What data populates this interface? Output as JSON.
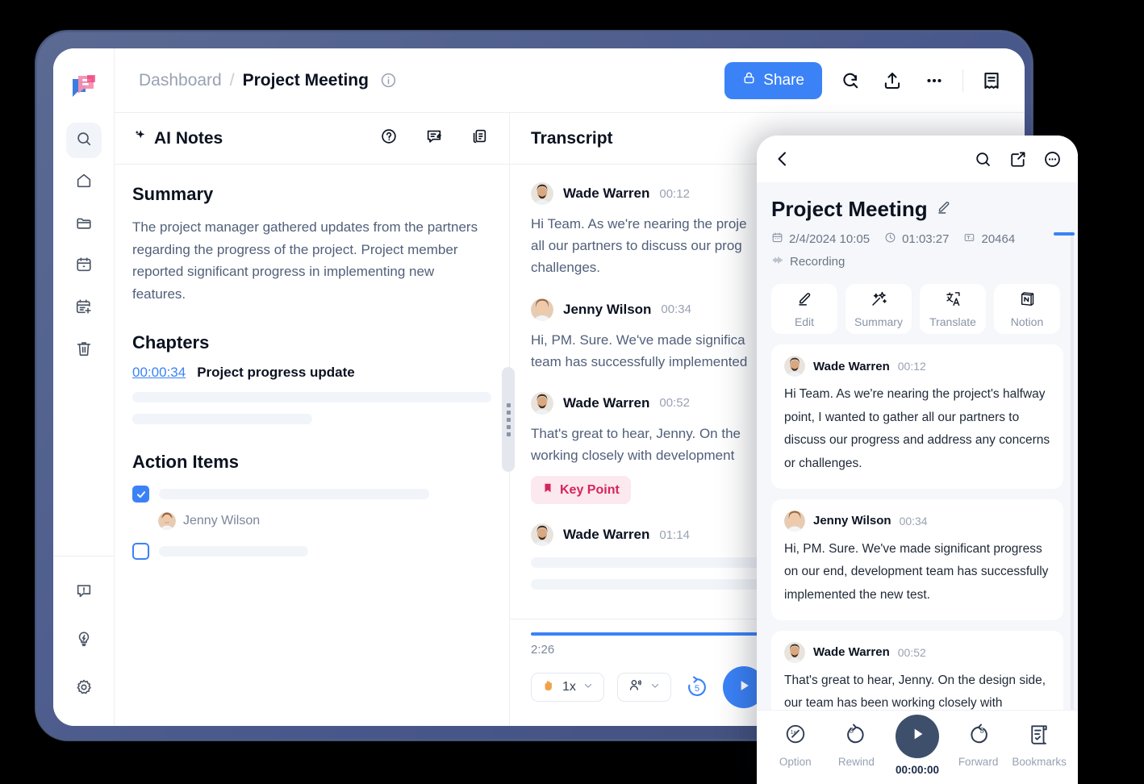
{
  "app": {
    "logo_icon": "app-logo-icon"
  },
  "sidebar": {
    "items": [
      {
        "name": "search",
        "icon": "search-icon",
        "active": true
      },
      {
        "name": "home",
        "icon": "home-icon",
        "active": false
      },
      {
        "name": "folder",
        "icon": "folder-icon",
        "active": false
      },
      {
        "name": "calendar",
        "icon": "calendar-icon",
        "active": false
      },
      {
        "name": "calendar-add",
        "icon": "calendar-plus-icon",
        "active": false
      },
      {
        "name": "trash",
        "icon": "trash-icon",
        "active": false
      }
    ],
    "bottom_items": [
      {
        "name": "feedback",
        "icon": "message-alert-icon"
      },
      {
        "name": "tips",
        "icon": "lightbulb-icon"
      },
      {
        "name": "settings",
        "icon": "gear-icon"
      }
    ]
  },
  "topbar": {
    "breadcrumb_root": "Dashboard",
    "breadcrumb_sep": "/",
    "breadcrumb_current": "Project Meeting",
    "info_icon": "info-circle-icon",
    "share_label": "Share",
    "share_icon": "lock-icon",
    "share_color": "#3b82f6",
    "actions": [
      {
        "name": "search-in-page",
        "icon": "search-refresh-icon"
      },
      {
        "name": "export",
        "icon": "upload-icon"
      },
      {
        "name": "more",
        "icon": "ellipsis-icon"
      },
      {
        "name": "notes-toggle",
        "icon": "receipt-icon"
      }
    ]
  },
  "notes_panel": {
    "title": "AI Notes",
    "title_icon": "sparkle-icon",
    "header_icons": [
      {
        "name": "help",
        "icon": "question-circle-icon"
      },
      {
        "name": "comment",
        "icon": "message-edit-icon"
      },
      {
        "name": "copy",
        "icon": "copy-icon"
      }
    ],
    "summary_heading": "Summary",
    "summary_text": "The project manager gathered updates from the partners regarding the progress of the project. Project member reported significant progress in implementing new features.",
    "chapters_heading": "Chapters",
    "chapter": {
      "time": "00:00:34",
      "title": "Project progress update"
    },
    "chapter_skeletons": [
      {
        "width": "100%"
      },
      {
        "width": "50%"
      }
    ],
    "action_items_heading": "Action Items",
    "action_items": [
      {
        "checked": true,
        "skeleton_width": "97%",
        "assignee": "Jenny Wilson"
      },
      {
        "checked": false,
        "skeleton_width": "54%",
        "assignee": null
      }
    ]
  },
  "transcript_panel": {
    "title": "Transcript",
    "entries": [
      {
        "speaker": "Wade Warren",
        "time": "00:12",
        "text": "Hi Team. As we're nearing the proje\nall our partners to discuss our prog\nchallenges.",
        "badge": null
      },
      {
        "speaker": "Jenny Wilson",
        "time": "00:34",
        "text": "Hi, PM. Sure. We've made significa\nteam has successfully implemented",
        "badge": null
      },
      {
        "speaker": "Wade Warren",
        "time": "00:52",
        "text": "That's great to hear, Jenny. On the\nworking closely with development",
        "badge": "Key Point"
      },
      {
        "speaker": "Wade Warren",
        "time": "01:14",
        "text": "",
        "badge": null
      }
    ],
    "key_point_label": "Key Point",
    "key_point_icon": "bookmark-icon",
    "key_point_color": "#d4265c"
  },
  "player": {
    "progress_percent": 82,
    "elapsed": "2:26",
    "speed_label": "1x",
    "speed_icon": "hand-icon",
    "speaker_icon": "speakers-icon",
    "rewind_label": "5",
    "rewind_icon": "rewind-5-icon",
    "play_icon": "play-icon"
  },
  "phone": {
    "topbar": {
      "back_icon": "chevron-left-icon",
      "actions": [
        {
          "name": "search",
          "icon": "search-icon"
        },
        {
          "name": "compose",
          "icon": "edit-square-icon"
        },
        {
          "name": "more",
          "icon": "ellipsis-circle-icon"
        }
      ]
    },
    "title": "Project Meeting",
    "title_edit_icon": "pencil-icon",
    "meta": {
      "date": "2/4/2024 10:05",
      "date_icon": "calendar-icon",
      "duration": "01:03:27",
      "duration_icon": "clock-icon",
      "words": "20464",
      "words_icon": "text-icon",
      "status": "Recording",
      "status_icon": "waveform-icon"
    },
    "chips": [
      {
        "label": "Edit",
        "icon": "pencil-icon"
      },
      {
        "label": "Summary",
        "icon": "sparkle-wand-icon"
      },
      {
        "label": "Translate",
        "icon": "translate-icon"
      },
      {
        "label": "Notion",
        "icon": "notion-icon"
      },
      {
        "label": "",
        "icon": "partial-icon"
      }
    ],
    "transcript": [
      {
        "speaker": "Wade Warren",
        "time": "00:12",
        "text": "Hi Team. As we're nearing the project's halfway point, I wanted to gather all our partners to discuss our progress and address any concerns or challenges."
      },
      {
        "speaker": "Jenny Wilson",
        "time": "00:34",
        "text": "Hi, PM. Sure. We've made significant progress on our end, development team has successfully implemented the new test."
      },
      {
        "speaker": "Wade Warren",
        "time": "00:52",
        "text": "That's great to hear, Jenny. On the design side, our team has been working closely with development"
      }
    ],
    "bottom_bar": {
      "items": [
        {
          "label": "Option",
          "icon": "speed-1x-icon",
          "strong": false
        },
        {
          "label": "Rewind",
          "icon": "rewind-3-icon",
          "strong": false
        },
        {
          "label": "00:00:00",
          "icon": "play-icon",
          "strong": true
        },
        {
          "label": "Forward",
          "icon": "forward-3-icon",
          "strong": false
        },
        {
          "label": "Bookmarks",
          "icon": "bookmark-list-icon",
          "strong": false
        }
      ],
      "play_color": "#3d4f6b"
    }
  }
}
